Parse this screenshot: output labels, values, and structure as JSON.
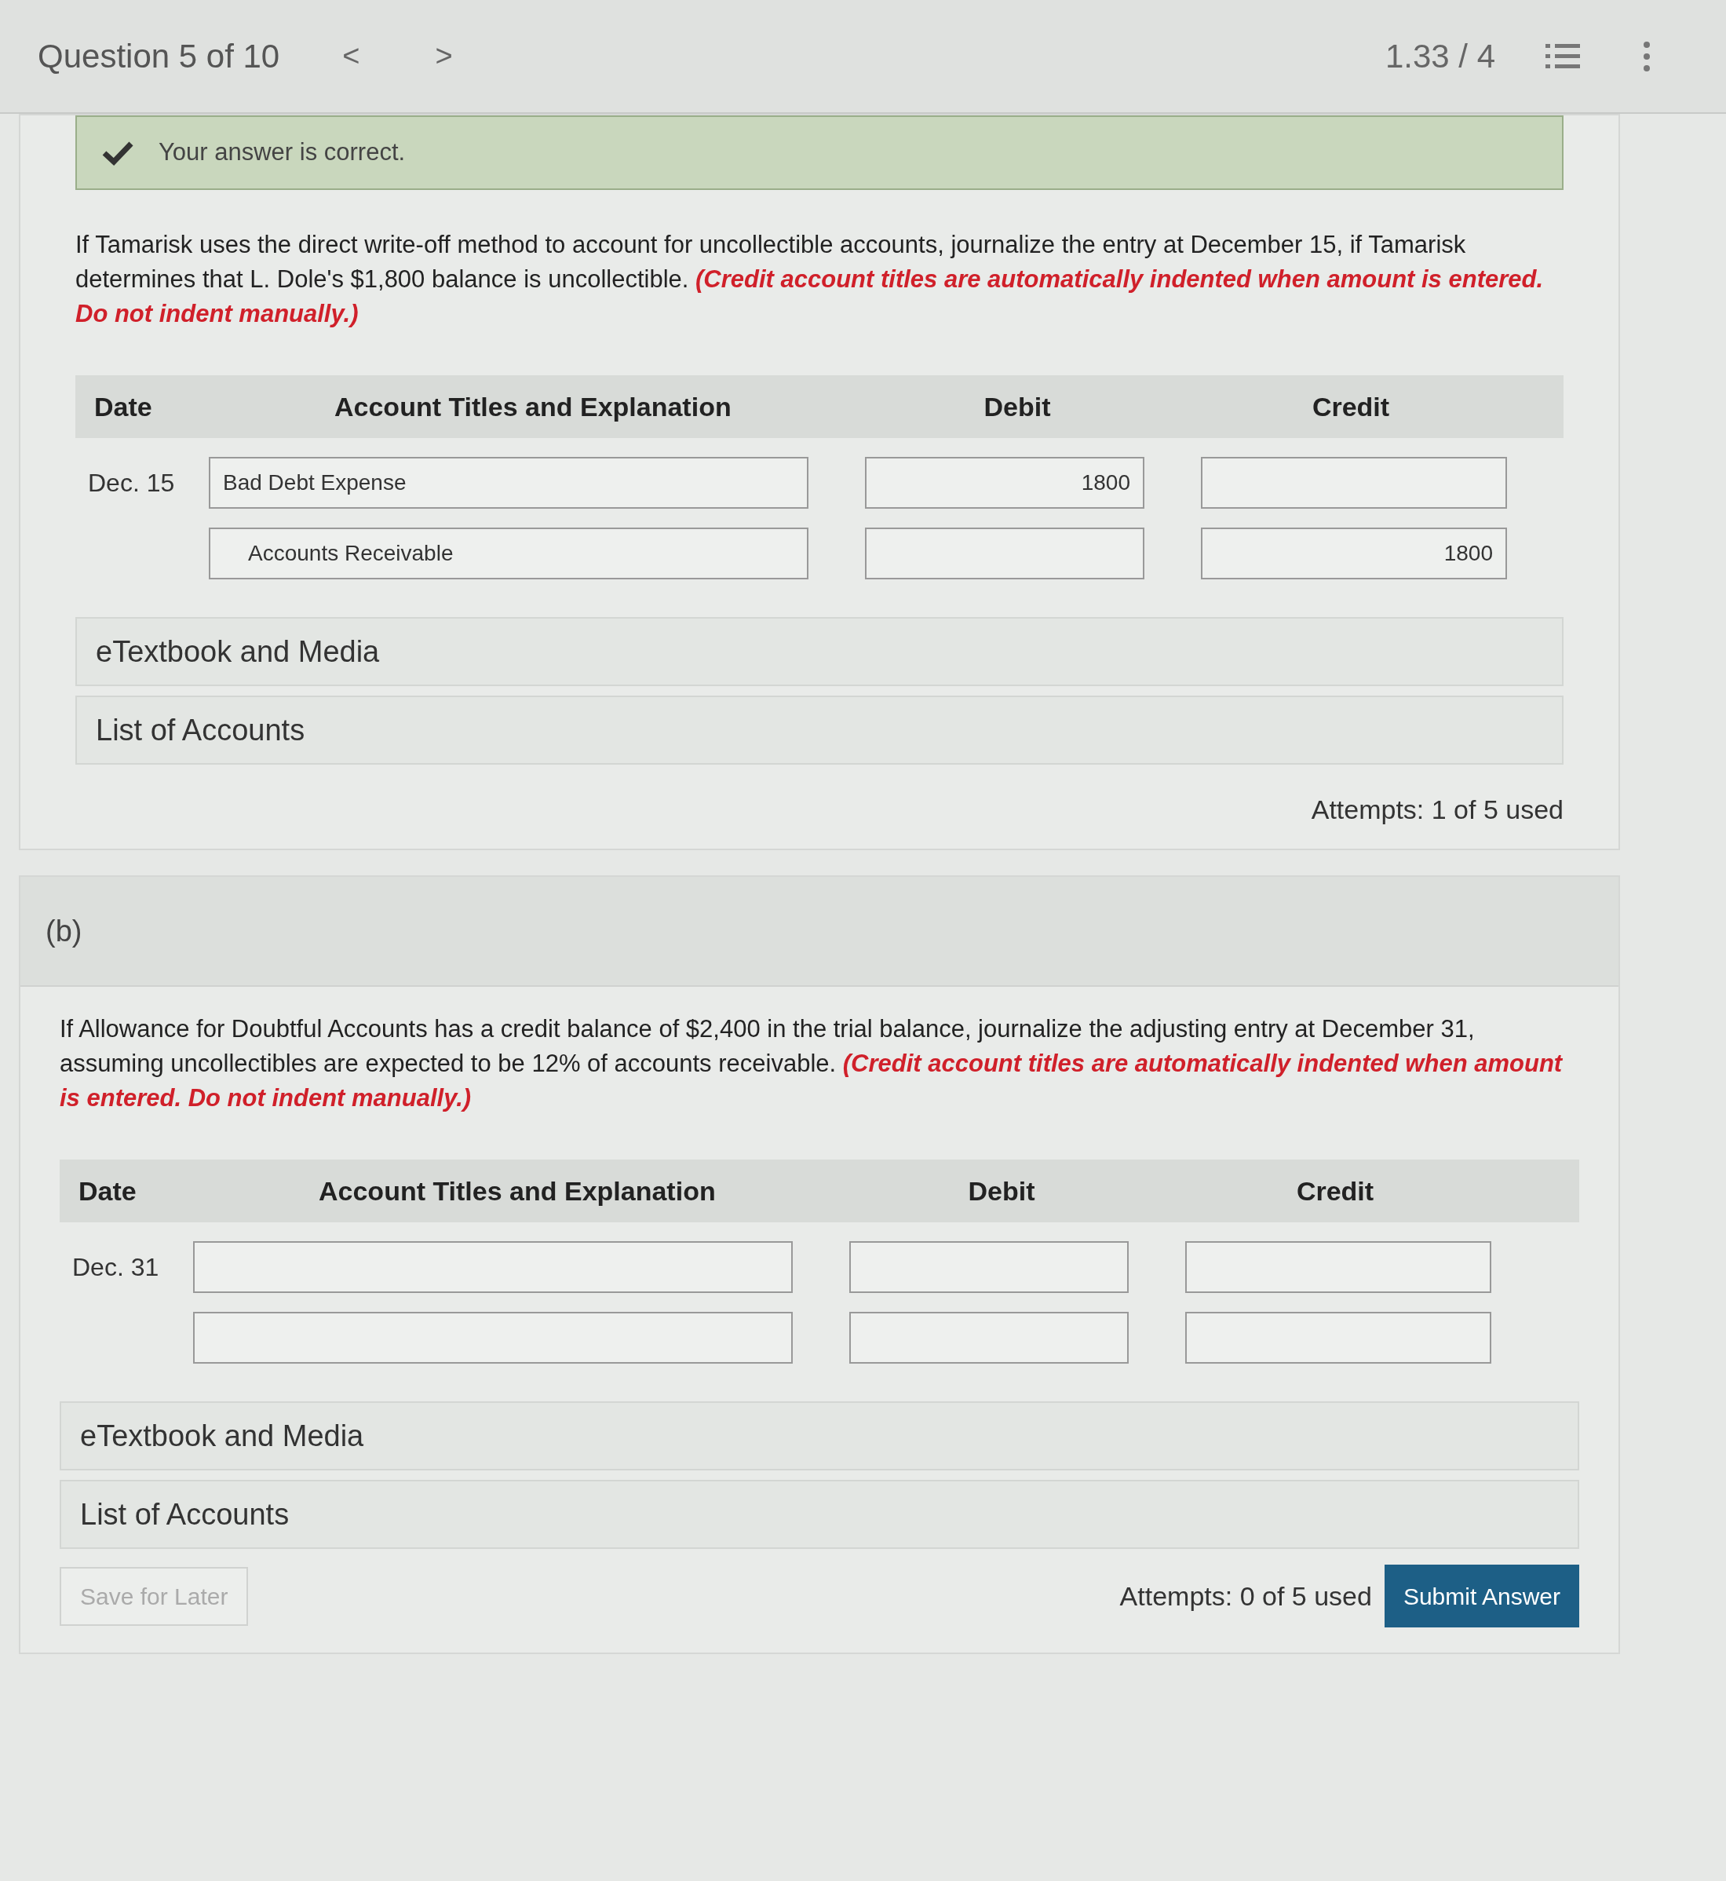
{
  "header": {
    "question_label": "Question 5 of 10",
    "prev": "<",
    "next": ">",
    "score": "1.33 / 4"
  },
  "part_a": {
    "feedback": {
      "correct": true,
      "text": "Your answer is correct."
    },
    "prompt": {
      "text": "If Tamarisk uses the direct write-off method to account for uncollectible accounts, journalize the entry at December 15, if Tamarisk determines that L. Dole's $1,800 balance is uncollectible.",
      "note": "(Credit account titles are automatically indented when amount is entered. Do not indent manually.)"
    },
    "table": {
      "columns": [
        "Date",
        "Account Titles and Explanation",
        "Debit",
        "Credit"
      ],
      "rows": [
        {
          "date": "Dec. 15",
          "account": "Bad Debt Expense",
          "debit": "1800",
          "indented": false
        },
        {
          "account": "Accounts Receivable",
          "credit": "1800",
          "indented": true
        }
      ]
    },
    "links": [
      "eTextbook and Media",
      "List of Accounts"
    ],
    "attempts": "Attempts: 1 of 5 used"
  },
  "part_b": {
    "label": "(b)",
    "prompt": {
      "text": "If Allowance for Doubtful Accounts has a credit balance of $2,400 in the trial balance, journalize the adjusting entry at December 31, assuming uncollectibles are expected to be 12% of accounts receivable.",
      "note": "(Credit account titles are automatically indented when amount is entered. Do not indent manually.)"
    },
    "table": {
      "columns": [
        "Date",
        "Account Titles and Explanation",
        "Debit",
        "Credit"
      ],
      "rows": [
        {
          "date": "Dec. 31"
        },
        {}
      ]
    },
    "links": [
      "eTextbook and Media",
      "List of Accounts"
    ],
    "save_button": {
      "label": "Save for Later",
      "disabled": true
    },
    "attempts": "Attempts: 0 of 5 used",
    "submit_button": {
      "label": "Submit Answer",
      "disabled": false
    }
  }
}
